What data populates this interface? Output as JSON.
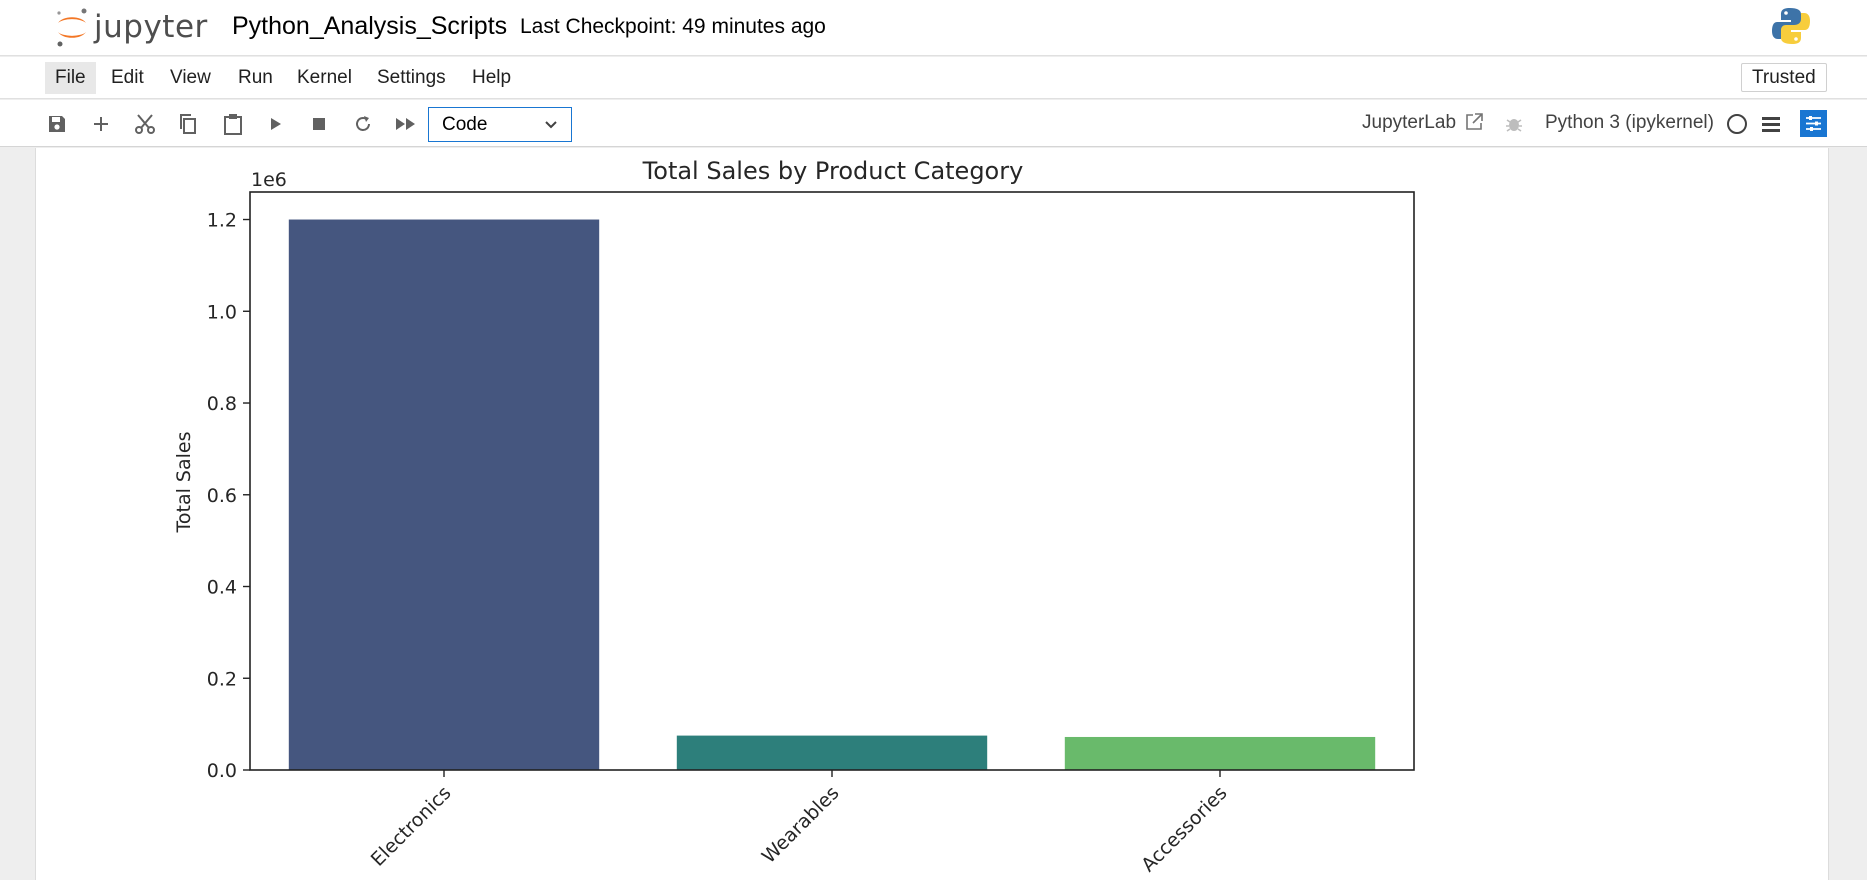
{
  "header": {
    "logo_text": "jupyter",
    "notebook_title": "Python_Analysis_Scripts",
    "checkpoint": "Last Checkpoint: 49 minutes ago"
  },
  "menu": {
    "items": [
      "File",
      "Edit",
      "View",
      "Run",
      "Kernel",
      "Settings",
      "Help"
    ],
    "trusted": "Trusted"
  },
  "toolbar": {
    "cell_type": "Code",
    "jupyterlab_label": "JupyterLab",
    "kernel_name": "Python 3 (ipykernel)"
  },
  "colors": {
    "accent": "#1976d2",
    "jupyter_orange": "#f37726"
  },
  "chart_data": {
    "type": "bar",
    "title": "Total Sales by Product Category",
    "xlabel": "",
    "ylabel": "Total Sales",
    "offset_label": "1e6",
    "categories": [
      "Electronics",
      "Wearables",
      "Accessories"
    ],
    "values": [
      1200000,
      75000,
      72000
    ],
    "colors": [
      "#45567f",
      "#2d7f7b",
      "#69ba6b"
    ],
    "ylim": [
      0,
      1260000
    ],
    "yticks": [
      0,
      200000,
      400000,
      600000,
      800000,
      1000000,
      1200000
    ],
    "ytick_labels": [
      "0.0",
      "0.2",
      "0.4",
      "0.6",
      "0.8",
      "1.0",
      "1.2"
    ],
    "grid": false,
    "xtick_rotation": 45
  }
}
